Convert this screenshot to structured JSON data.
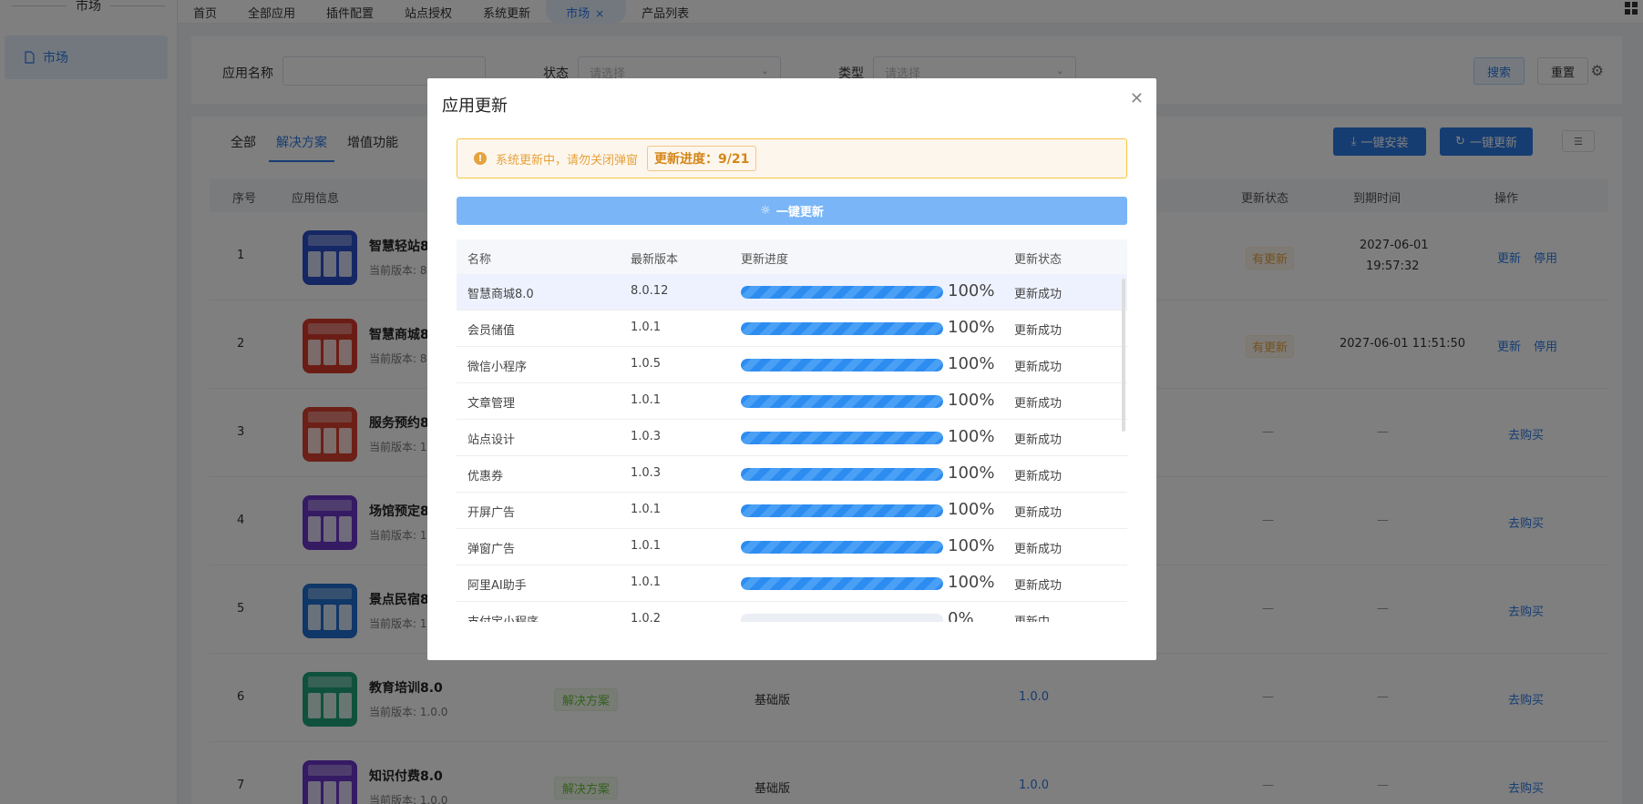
{
  "sidebar": {
    "title": "市场",
    "item_label": "市场"
  },
  "topbar": {
    "tabs": [
      "首页",
      "全部应用",
      "插件配置",
      "站点授权",
      "系统更新",
      "市场",
      "产品列表"
    ],
    "active_close": "×"
  },
  "filters": {
    "app_name_label": "应用名称",
    "status_label": "状态",
    "status_placeholder": "请选择",
    "type_label": "类型",
    "type_placeholder": "请选择",
    "search_label": "搜索",
    "reset_label": "重置"
  },
  "list": {
    "sub_tabs": [
      "全部",
      "解决方案",
      "增值功能"
    ],
    "install_all_label": "一键安装",
    "update_all_label": "一键更新",
    "columns": {
      "index": "序号",
      "app_info": "应用信息",
      "update_status": "更新状态",
      "expire_time": "到期时间",
      "actions": "操作"
    },
    "rows": [
      {
        "index": "1",
        "name": "智慧轻站8",
        "version": "当前版本: 8.",
        "status": "有更新",
        "expire_date": "2027-06-01",
        "expire_time": "19:57:32",
        "act1": "更新",
        "act2": "停用"
      },
      {
        "index": "2",
        "name": "智慧商城8",
        "version": "当前版本: 8.",
        "status": "有更新",
        "expire": "2027-06-01 11:51:50",
        "act1": "更新",
        "act2": "停用"
      },
      {
        "index": "3",
        "name": "服务预约8",
        "version": "当前版本: 1.",
        "status": "—",
        "expire": "—",
        "act1": "去购买"
      },
      {
        "index": "4",
        "name": "场馆预定8",
        "version": "当前版本: 1.",
        "status": "—",
        "expire": "—",
        "act1": "去购买"
      },
      {
        "index": "5",
        "name": "景点民宿8",
        "version": "当前版本: 1.",
        "status": "—",
        "expire": "—",
        "act1": "去购买"
      },
      {
        "index": "6",
        "name": "教育培训8.0",
        "version": "当前版本: 1.0.0",
        "category": "解决方案",
        "edition": "基础版",
        "latest": "1.0.0",
        "status": "—",
        "expire": "—",
        "act1": "去购买"
      },
      {
        "index": "7",
        "name": "知识付费8.0",
        "version": "当前版本: 1.0.0",
        "category": "解决方案",
        "edition": "基础版",
        "latest": "1.0.0",
        "status": "—",
        "expire": "—",
        "act1": "去购买"
      }
    ],
    "thumb_colors": [
      "#2b4fc9",
      "#d63b2a",
      "#d9412e",
      "#6a34c9",
      "#1f6fd1",
      "#1fa37a",
      "#6a34c9"
    ]
  },
  "modal": {
    "title": "应用更新",
    "alert_text": "系统更新中，请勿关闭弹窗",
    "progress_label": "更新进度：9/21",
    "update_button_label": "一键更新",
    "columns": {
      "name": "名称",
      "latest": "最新版本",
      "progress": "更新进度",
      "status": "更新状态"
    },
    "rows": [
      {
        "name": "智慧商城8.0",
        "latest": "8.0.12",
        "progress": 100,
        "progress_text": "100%",
        "status": "更新成功"
      },
      {
        "name": "会员储值",
        "latest": "1.0.1",
        "progress": 100,
        "progress_text": "100%",
        "status": "更新成功"
      },
      {
        "name": "微信小程序",
        "latest": "1.0.5",
        "progress": 100,
        "progress_text": "100%",
        "status": "更新成功"
      },
      {
        "name": "文章管理",
        "latest": "1.0.1",
        "progress": 100,
        "progress_text": "100%",
        "status": "更新成功"
      },
      {
        "name": "站点设计",
        "latest": "1.0.3",
        "progress": 100,
        "progress_text": "100%",
        "status": "更新成功"
      },
      {
        "name": "优惠券",
        "latest": "1.0.3",
        "progress": 100,
        "progress_text": "100%",
        "status": "更新成功"
      },
      {
        "name": "开屏广告",
        "latest": "1.0.1",
        "progress": 100,
        "progress_text": "100%",
        "status": "更新成功"
      },
      {
        "name": "弹窗广告",
        "latest": "1.0.1",
        "progress": 100,
        "progress_text": "100%",
        "status": "更新成功"
      },
      {
        "name": "阿里AI助手",
        "latest": "1.0.1",
        "progress": 100,
        "progress_text": "100%",
        "status": "更新成功"
      },
      {
        "name": "支付宝小程序",
        "latest": "1.0.2",
        "progress": 0,
        "progress_text": "0%",
        "status": "更新中"
      }
    ]
  }
}
